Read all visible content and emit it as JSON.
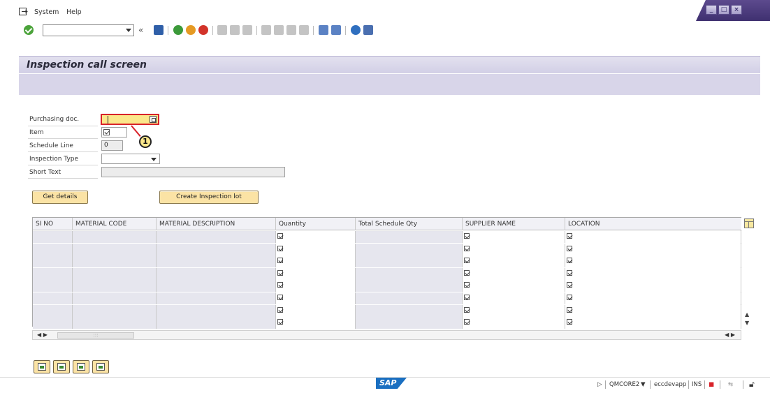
{
  "menu": {
    "system": "System",
    "help": "Help"
  },
  "window": {
    "minimize": "_",
    "maximize": "□",
    "close": "×"
  },
  "title": "Inspection call screen",
  "form": {
    "purchasing_doc_label": "Purchasing doc.",
    "purchasing_doc_value": "",
    "item_label": "Item",
    "schedule_line_label": "Schedule Line",
    "schedule_line_value": "0",
    "inspection_type_label": "Inspection Type",
    "short_text_label": "Short Text"
  },
  "callout": "1",
  "buttons": {
    "get_details": "Get details",
    "create_lot": "Create Inspection lot"
  },
  "table": {
    "headers": [
      "SI NO",
      "MATERIAL CODE",
      "MATERIAL DESCRIPTION",
      "Quantity",
      "Total Schedule Qty",
      "SUPPLIER NAME",
      "LOCATION"
    ],
    "row_count": 8
  },
  "status": {
    "transaction": "QMCORE2",
    "server": "eccdevapp",
    "mode": "INS"
  },
  "colors": {
    "required_field": "#fbe78b",
    "highlight": "#d8232a",
    "title_bg": "#d2cfe6",
    "button": "#fbe3a5"
  }
}
